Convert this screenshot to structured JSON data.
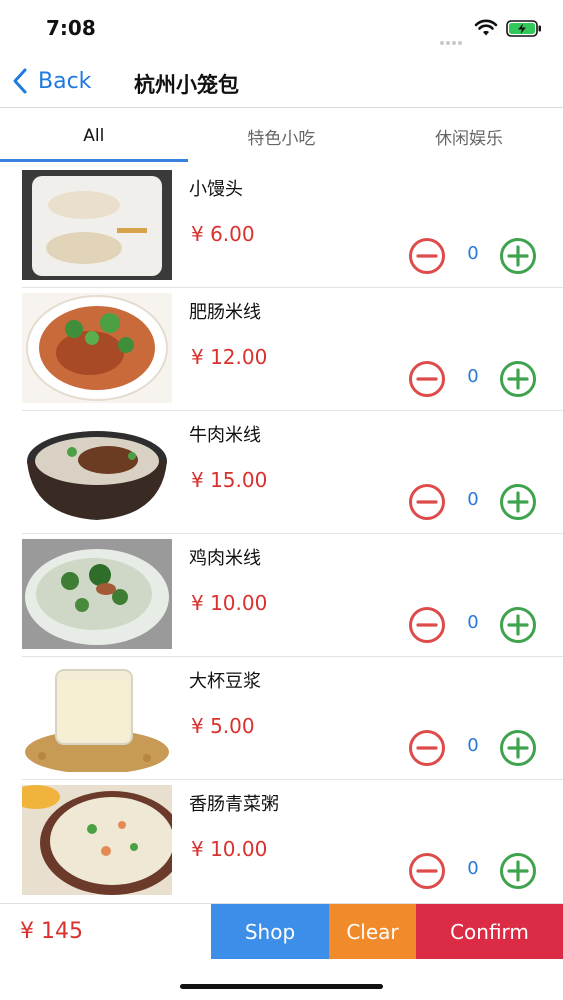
{
  "status_bar": {
    "time": "7:08"
  },
  "nav": {
    "back_label": "Back",
    "title": "杭州小笼包"
  },
  "tabs": [
    {
      "label": "All",
      "active": true
    },
    {
      "label": "特色小吃",
      "active": false
    },
    {
      "label": "休闲娱乐",
      "active": false
    }
  ],
  "items": [
    {
      "name": "小馒头",
      "price": "¥ 6.00",
      "qty": "0",
      "image": "steamed-buns"
    },
    {
      "name": "肥肠米线",
      "price": "¥ 12.00",
      "qty": "0",
      "image": "intestine-rice-noodles"
    },
    {
      "name": "牛肉米线",
      "price": "¥ 15.00",
      "qty": "0",
      "image": "beef-rice-noodles"
    },
    {
      "name": "鸡肉米线",
      "price": "¥ 10.00",
      "qty": "0",
      "image": "chicken-rice-noodles"
    },
    {
      "name": "大杯豆浆",
      "price": "¥ 5.00",
      "qty": "0",
      "image": "soy-milk"
    },
    {
      "name": "香肠青菜粥",
      "price": "¥ 10.00",
      "qty": "0",
      "image": "sausage-vegetable-porridge"
    }
  ],
  "bottom_bar": {
    "total": "¥ 145",
    "shop_label": "Shop",
    "clear_label": "Clear",
    "confirm_label": "Confirm"
  },
  "colors": {
    "accent_blue": "#1f7ae0",
    "price_red": "#d9322e",
    "minus_red": "#dd4b4b",
    "plus_green": "#3fa34d",
    "shop": "#3d8ee8",
    "clear": "#f08a2b",
    "confirm": "#dc2b44"
  }
}
